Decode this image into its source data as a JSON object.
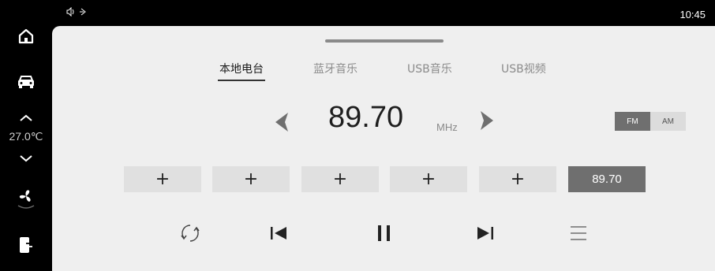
{
  "status": {
    "time": "10:45"
  },
  "sidebar": {
    "temperature": "27.0℃"
  },
  "tabs": [
    "本地电台",
    "蓝牙音乐",
    "USB音乐",
    "USB视频"
  ],
  "radio": {
    "frequency": "89.70",
    "unit": "MHz"
  },
  "bands": [
    "FM",
    "AM"
  ],
  "presets": [
    "+",
    "+",
    "+",
    "+",
    "+",
    "89.70"
  ],
  "colors": {
    "selected": "#6f6f6f",
    "panel": "#efefef",
    "button": "#e0e0e0"
  }
}
